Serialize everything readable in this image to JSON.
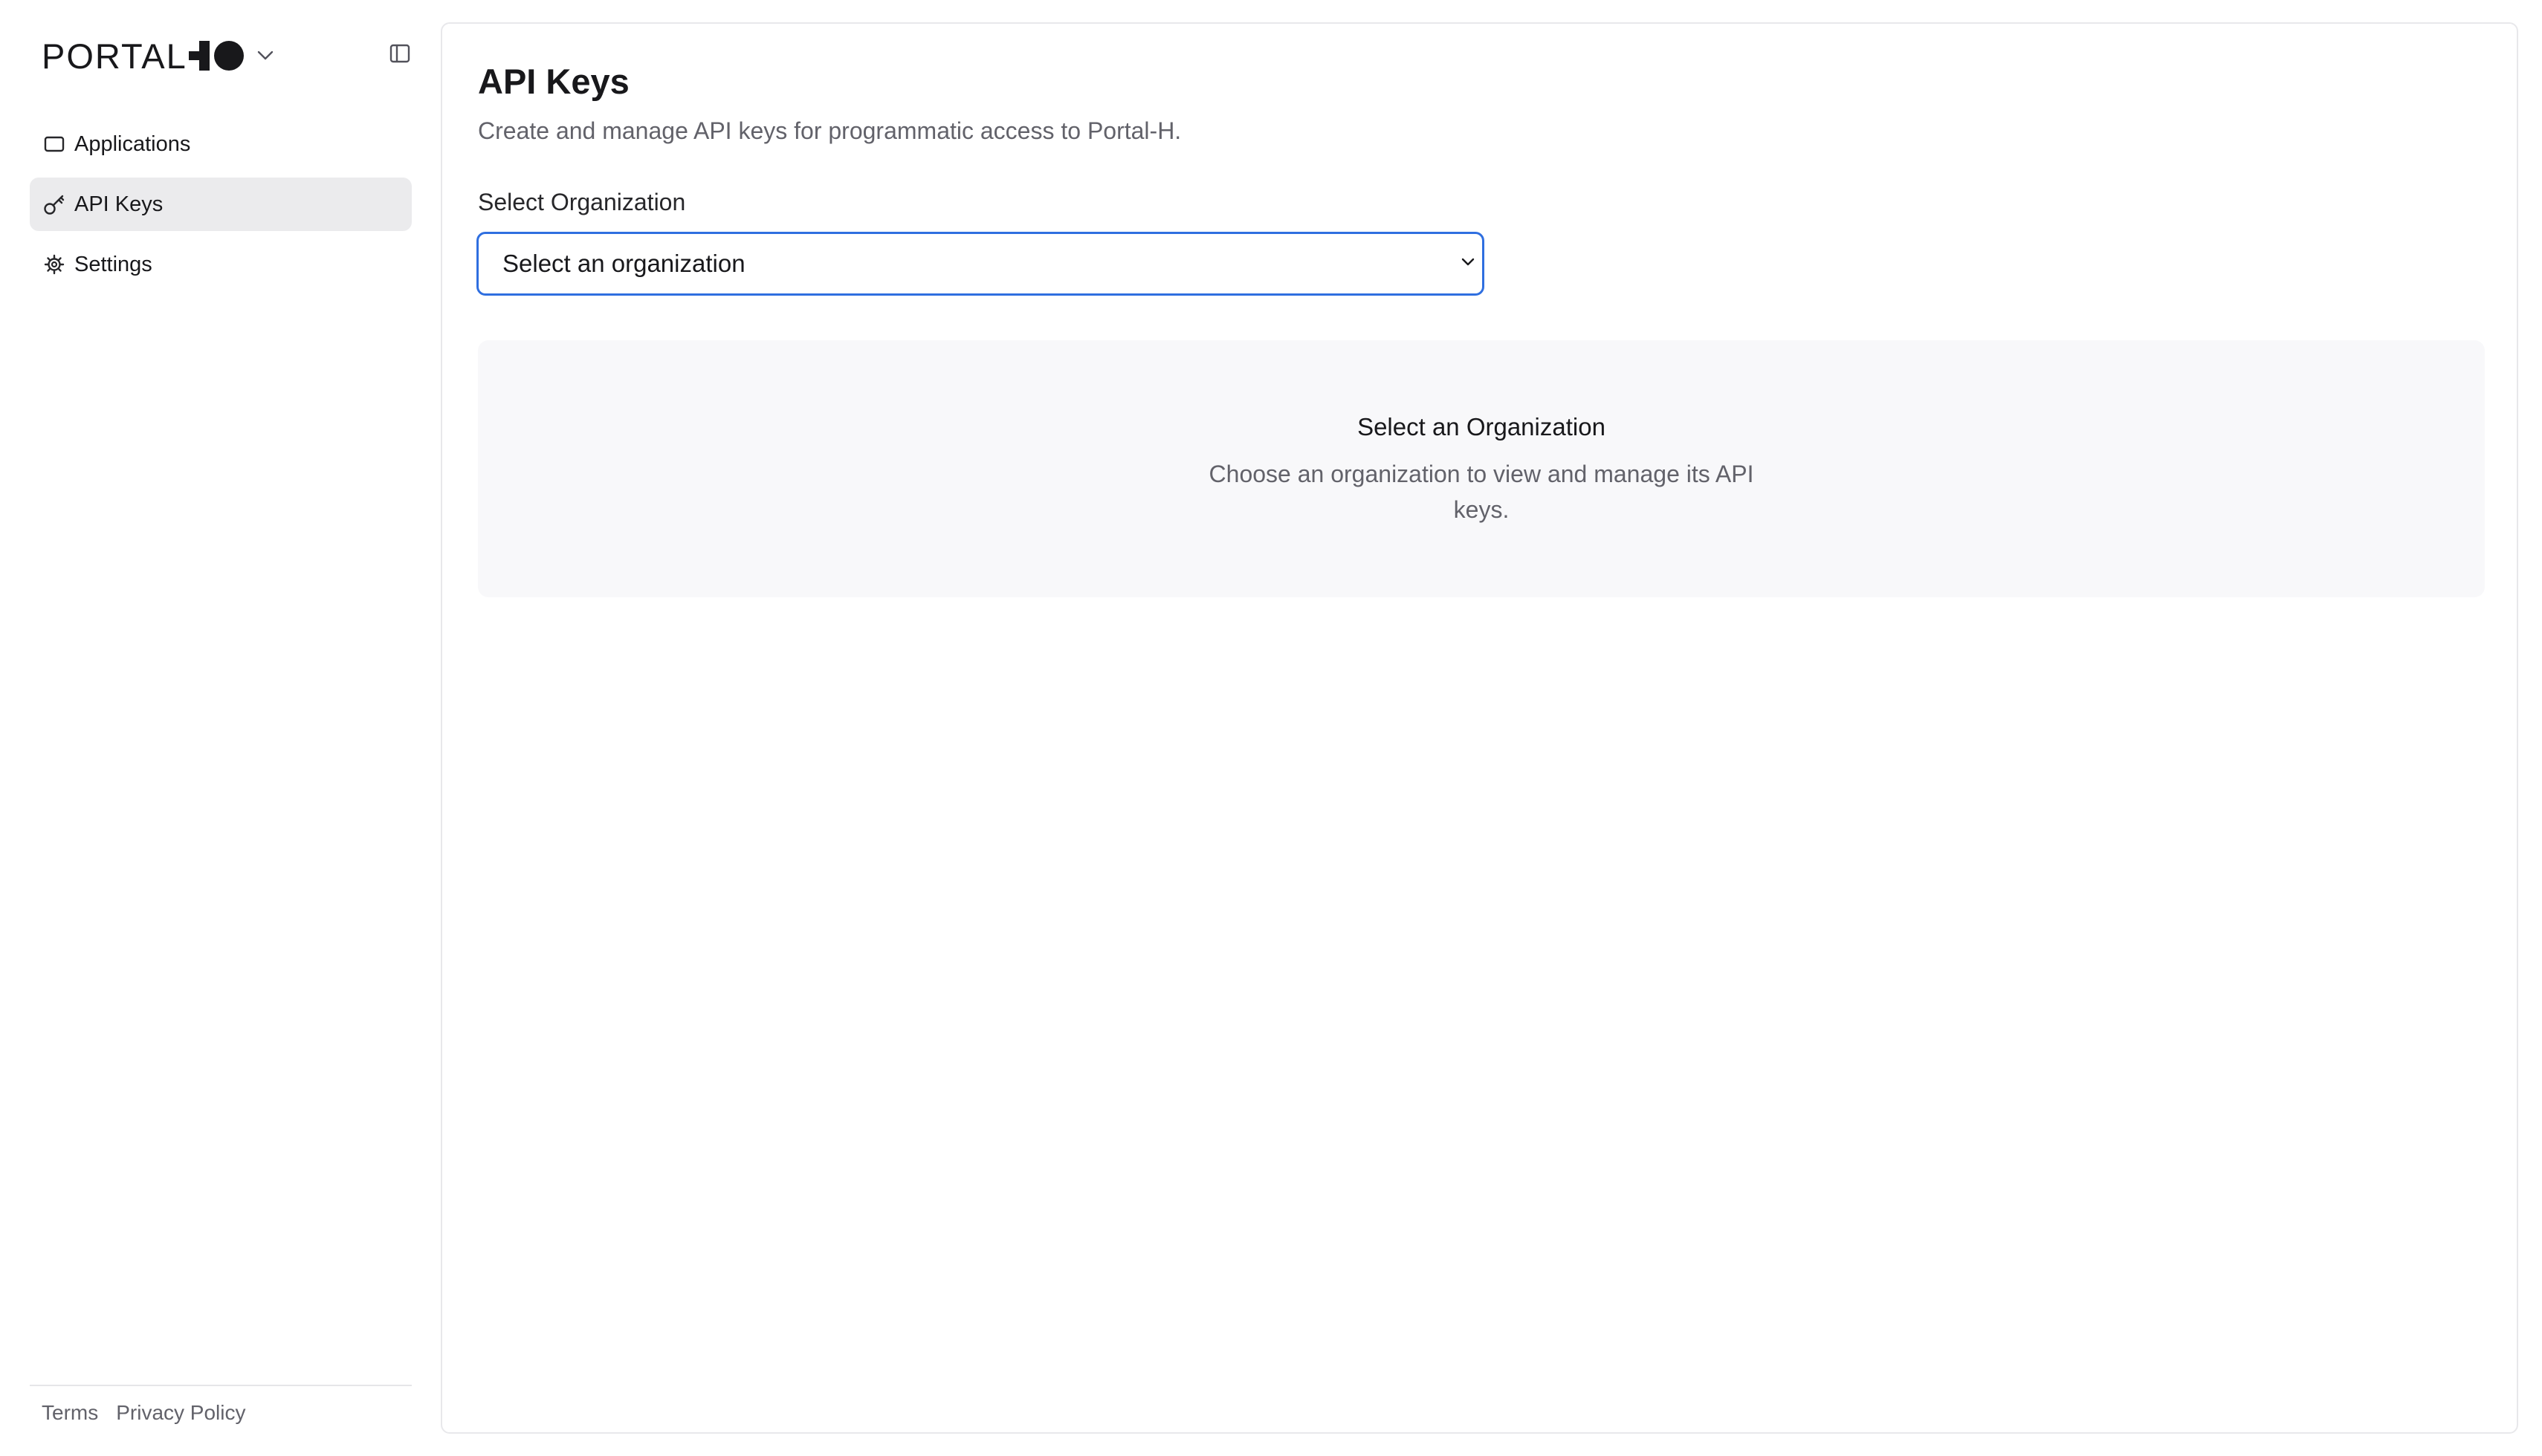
{
  "brand": {
    "name": "PORTAL"
  },
  "sidebar": {
    "items": [
      {
        "label": "Applications",
        "icon": "window-icon",
        "active": false
      },
      {
        "label": "API Keys",
        "icon": "key-icon",
        "active": true
      },
      {
        "label": "Settings",
        "icon": "gear-icon",
        "active": false
      }
    ],
    "footer": {
      "terms": "Terms",
      "privacy": "Privacy Policy"
    }
  },
  "main": {
    "title": "API Keys",
    "subtitle": "Create and manage API keys for programmatic access to Portal-H.",
    "field_label": "Select Organization",
    "select_value": "Select an organization",
    "empty_state": {
      "title": "Select an Organization",
      "description": "Choose an organization to view and manage its API keys."
    }
  },
  "colors": {
    "accent": "#2f6fe0",
    "active_nav_bg": "#ebebed",
    "empty_state_bg": "#f8f8fa",
    "muted_text": "#62626a"
  }
}
